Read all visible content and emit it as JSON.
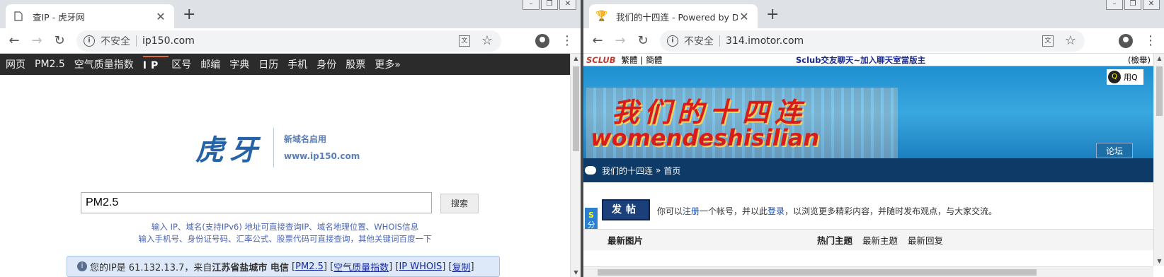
{
  "window1": {
    "tab": {
      "title": "查IP - 虎牙网",
      "favicon": "document-icon"
    },
    "new_tab": "+",
    "controls": [
      "–",
      "❐",
      "✕"
    ],
    "address": {
      "security": "不安全",
      "url": "ip150.com"
    },
    "nav": [
      "网页",
      "PM2.5",
      "空气质量指数",
      "IP",
      "区号",
      "邮编",
      "字典",
      "日历",
      "手机",
      "身份",
      "股票",
      "更多»"
    ],
    "logo": {
      "text": "虎牙",
      "tag1": "新域名启用",
      "tag2": "www.ip150.com"
    },
    "search": {
      "value": "PM2.5",
      "button": "搜索"
    },
    "hints": [
      "输入 IP、域名(支持IPv6) 地址可直接查询IP、域名地理位置、WHOIS信息",
      "输入手机号、身份证号码、汇率公式、股票代码可直接查询，其他关键词百度一下"
    ],
    "ip_info": {
      "prefix": "您的IP是 61.132.13.7，来自 ",
      "location": "江苏省盐城市 电信",
      "links": [
        "PM2.5",
        "空气质量指数",
        "IP WHOIS",
        "复制"
      ]
    }
  },
  "window2": {
    "tab": {
      "title": "我们的十四连 - Powered by Disc",
      "favicon": "trophy-icon"
    },
    "new_tab": "+",
    "controls": [
      "–",
      "❐",
      "✕"
    ],
    "address": {
      "security": "不安全",
      "url": "314.imotor.com"
    },
    "topstrip": {
      "brand": "SCLUB",
      "trad": "繁體",
      "simp": "簡體",
      "announce": "Sclub交友聊天~加入聊天室當版主",
      "search": "(檢舉)"
    },
    "banner": {
      "title_cn": "我们的十四连",
      "title_en": "womendeshisilian",
      "qq_label": "用Q"
    },
    "forum_tab": "论坛",
    "breadcrumb": {
      "home": "我们的十四连",
      "sep": "»",
      "current": "首页"
    },
    "post_button": "发帖",
    "register_line": {
      "pre": "你可以",
      "reg": "注册",
      "mid": "一个帐号，并以此",
      "login": "登录",
      "post": "，以浏览更多精彩内容，并随时发布观点，与大家交流。"
    },
    "share": {
      "s": "S",
      "text": "分享"
    },
    "section": {
      "left": "最新图片",
      "tabs": [
        "热门主题",
        "最新主题",
        "最新回复"
      ]
    }
  }
}
